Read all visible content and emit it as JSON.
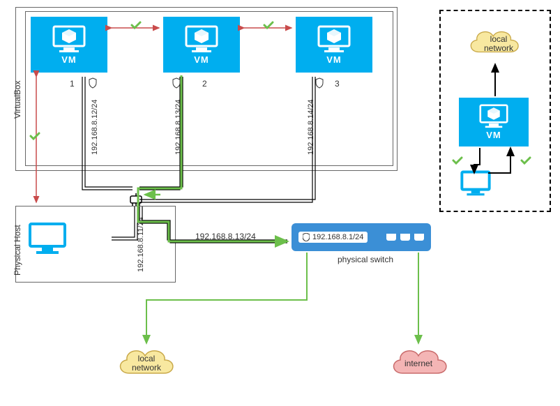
{
  "containers": {
    "virtualbox_label": "VirtualBox",
    "physical_host_label": "Physical Host"
  },
  "vms": [
    {
      "label": "VM",
      "num": "1",
      "ip": "192.168.8.12/24"
    },
    {
      "label": "VM",
      "num": "2",
      "ip": "192.168.8.13/24"
    },
    {
      "label": "VM",
      "num": "3",
      "ip": "192.168.8.14/24"
    }
  ],
  "host": {
    "ip": "192.168.8.11/24"
  },
  "switch": {
    "ip": "192.168.8.1/24",
    "caption": "physical switch",
    "flow_ip": "192.168.8.13/24"
  },
  "clouds": {
    "local": "local network",
    "internet": "internet"
  },
  "legend": {
    "cloud": "local network",
    "vm": "VM"
  },
  "colors": {
    "vm": "#00aeef",
    "switch": "#3b8fd6",
    "green": "#6cbf4b",
    "red": "#c94b4b",
    "yellow_cloud": "#f8e8a0",
    "red_cloud": "#f4b5b5"
  }
}
